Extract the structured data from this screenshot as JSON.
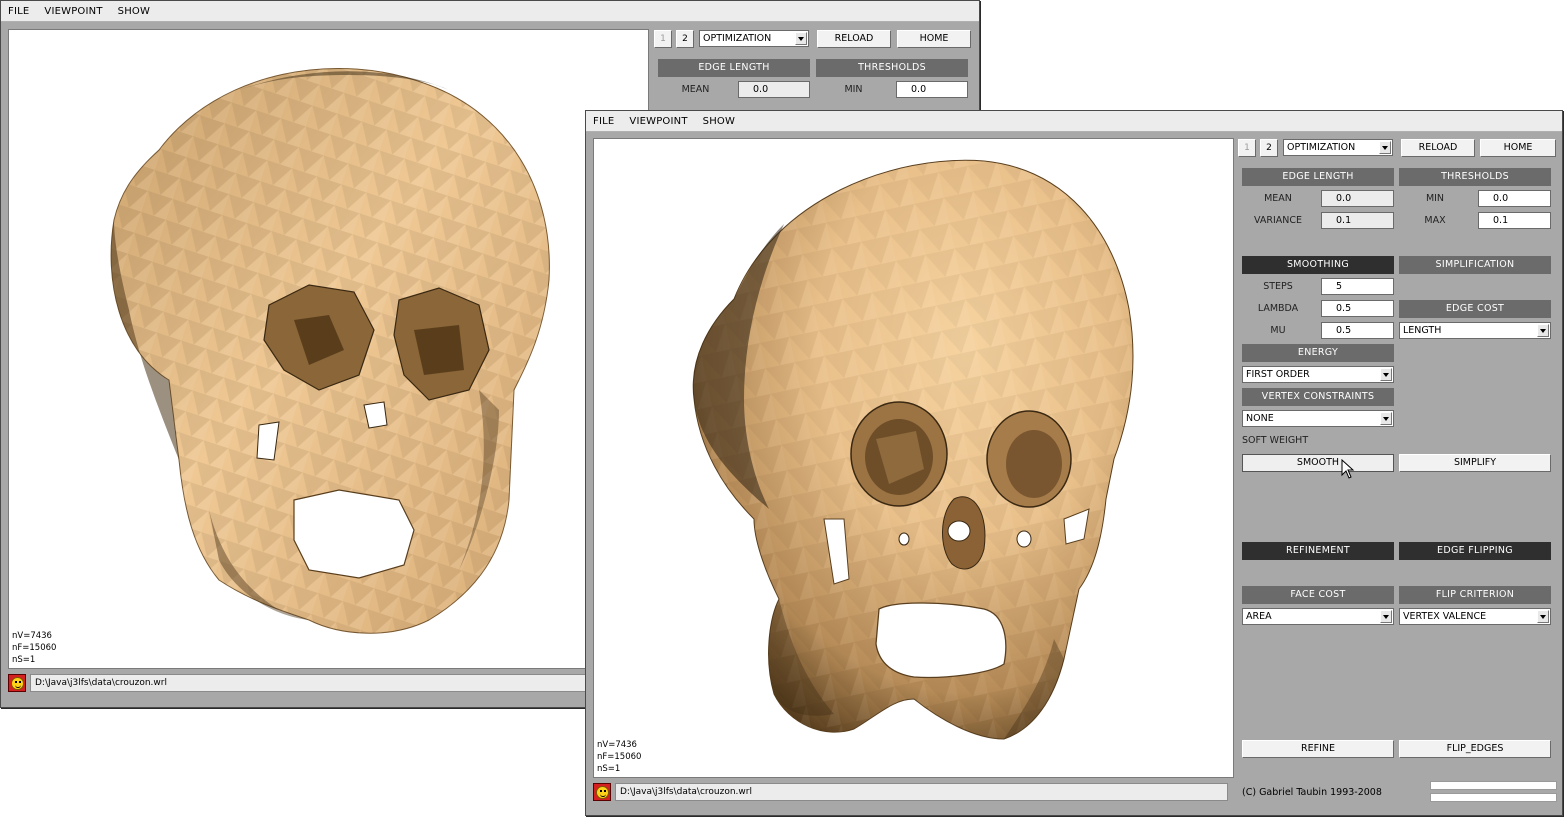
{
  "menu": [
    "FILE",
    "VIEWPOINT",
    "SHOW"
  ],
  "tabs": [
    "1",
    "2"
  ],
  "mode_select": "OPTIMIZATION",
  "buttons": {
    "reload": "RELOAD",
    "home": "HOME"
  },
  "edge_length": {
    "header": "EDGE LENGTH",
    "mean_label": "MEAN",
    "mean_value": "0.0",
    "variance_label": "VARIANCE",
    "variance_value": "0.1"
  },
  "thresholds": {
    "header": "THRESHOLDS",
    "min_label": "MIN",
    "min_value": "0.0",
    "max_label": "MAX",
    "max_value": "0.1"
  },
  "smoothing": {
    "header": "SMOOTHING",
    "steps_label": "STEPS",
    "steps_value": "5",
    "lambda_label": "LAMBDA",
    "lambda_value": "0.5",
    "mu_label": "MU",
    "mu_value": "0.5",
    "energy_header": "ENERGY",
    "energy_value": "FIRST ORDER",
    "vertex_constraints_header": "VERTEX CONSTRAINTS",
    "vertex_constraints_value": "NONE",
    "soft_weight_label": "SOFT WEIGHT",
    "smooth_button": "SMOOTH"
  },
  "simplification": {
    "header": "SIMPLIFICATION",
    "edge_cost_header": "EDGE COST",
    "edge_cost_value": "LENGTH",
    "simplify_button": "SIMPLIFY"
  },
  "refinement": {
    "header": "REFINEMENT",
    "face_cost_header": "FACE COST",
    "face_cost_value": "AREA",
    "refine_button": "REFINE"
  },
  "edge_flipping": {
    "header": "EDGE FLIPPING",
    "flip_criterion_header": "FLIP CRITERION",
    "flip_criterion_value": "VERTEX VALENCE",
    "flip_button": "FLIP_EDGES"
  },
  "stats": {
    "nv": "nV=7436",
    "nf": "nF=15060",
    "ns": "nS=1"
  },
  "file_path": "D:\\Java\\j3lfs\\data\\crouzon.wrl",
  "copyright": "(C) Gabriel Taubin 1993-2008",
  "colors": {
    "mesh": "#e8bf8a",
    "mesh_shadow": "#6e5230",
    "panel": "#a8a8a8",
    "header": "#6b6b6b",
    "header_active": "#2f2f2f"
  }
}
